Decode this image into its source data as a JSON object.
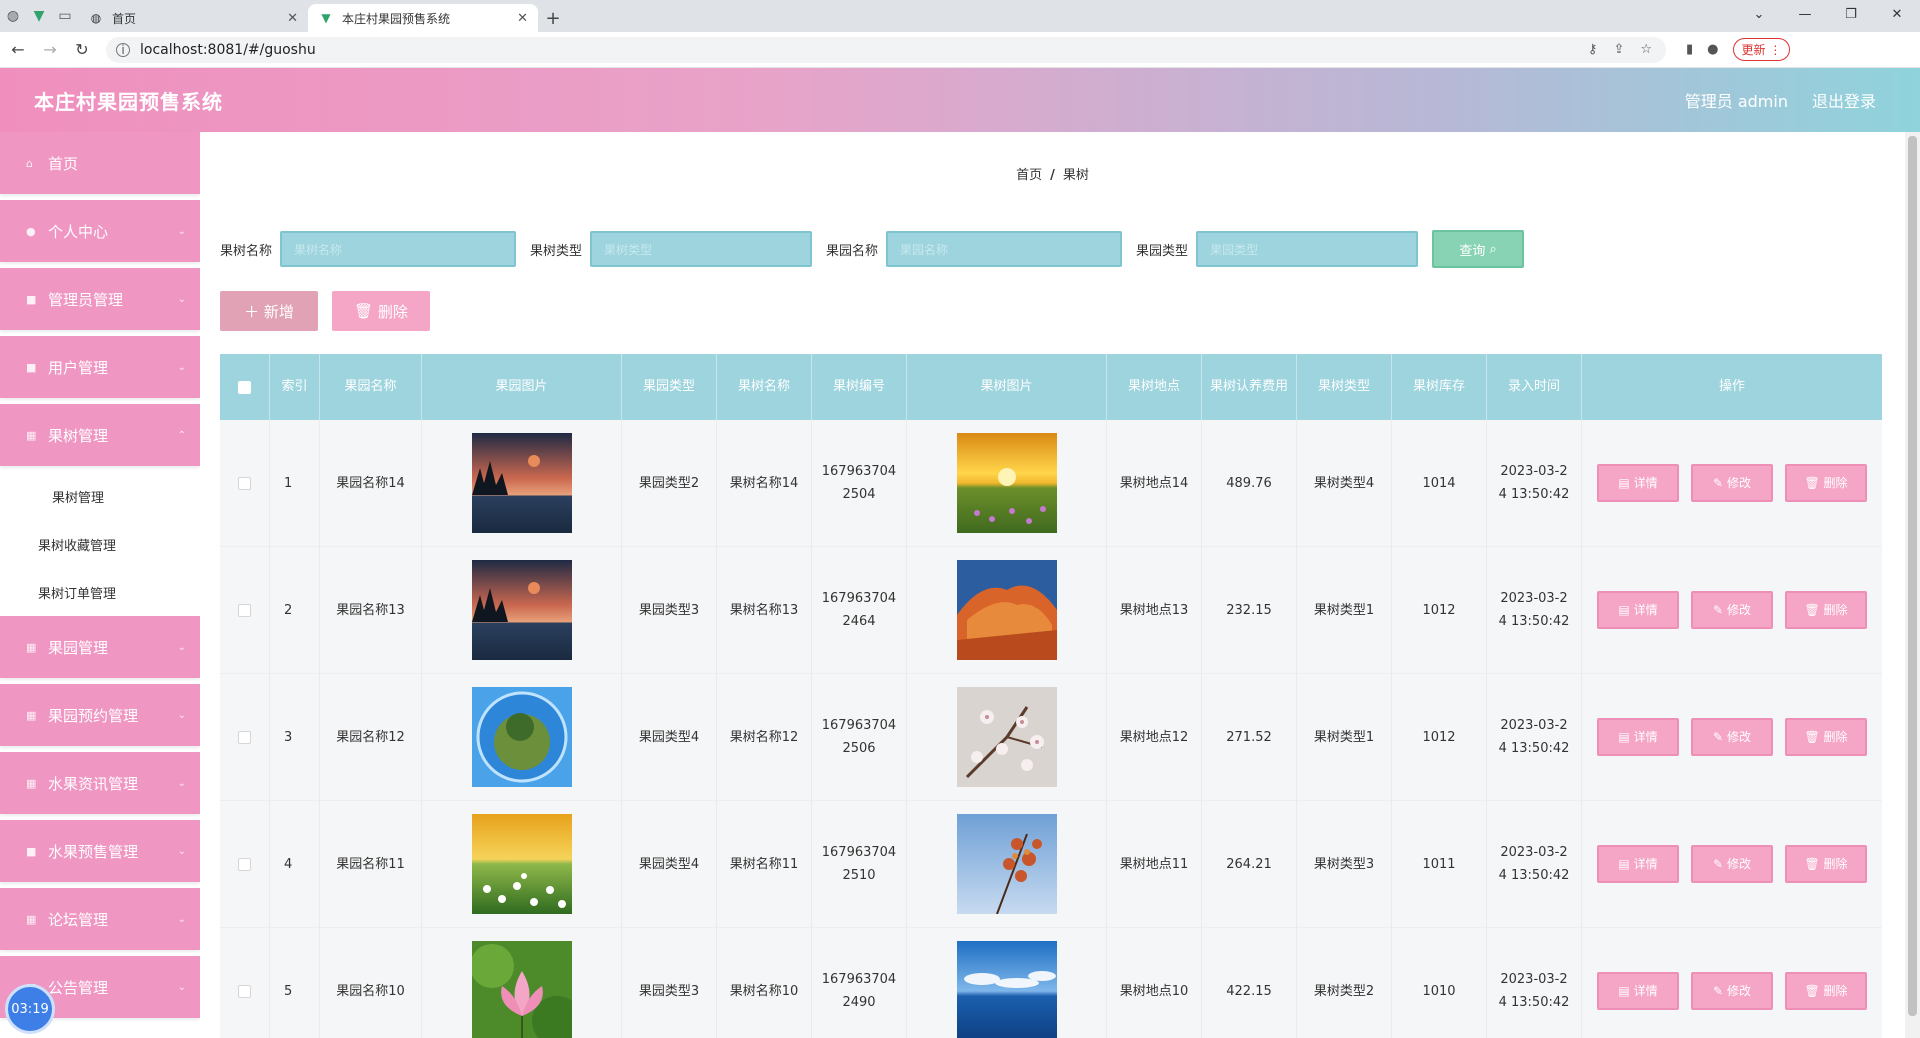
{
  "browser": {
    "tabs": [
      {
        "title": "首页"
      },
      {
        "title": "本庄村果园预售系统"
      }
    ],
    "url": "localhost:8081/#/guoshu",
    "update_label": "更新"
  },
  "header": {
    "title": "本庄村果园预售系统",
    "user": "管理员 admin",
    "logout": "退出登录"
  },
  "sidebar": {
    "items": [
      {
        "label": "首页"
      },
      {
        "label": "个人中心"
      },
      {
        "label": "管理员管理"
      },
      {
        "label": "用户管理"
      },
      {
        "label": "果树管理"
      },
      {
        "label": "果园管理"
      },
      {
        "label": "果园预约管理"
      },
      {
        "label": "水果资讯管理"
      },
      {
        "label": "水果预售管理"
      },
      {
        "label": "论坛管理"
      },
      {
        "label": "公告管理"
      }
    ],
    "submenu": [
      "果树管理",
      "果树收藏管理",
      "果树订单管理"
    ],
    "timer": "03:19"
  },
  "breadcrumb": {
    "home": "首页",
    "sep": "/",
    "current": "果树"
  },
  "search": {
    "labels": [
      "果树名称",
      "果树类型",
      "果园名称",
      "果园类型"
    ],
    "placeholders": [
      "果树名称",
      "果树类型",
      "果园名称",
      "果园类型"
    ],
    "button": "查询"
  },
  "actions": {
    "add": "新增",
    "delete": "删除"
  },
  "table": {
    "headers": [
      "索引",
      "果园名称",
      "果园图片",
      "果园类型",
      "果树名称",
      "果树编号",
      "果树图片",
      "果树地点",
      "果树认养费用",
      "果树类型",
      "果树库存",
      "录入时间",
      "操作"
    ],
    "op_labels": {
      "detail": "详情",
      "edit": "修改",
      "delete": "删除"
    },
    "rows": [
      {
        "index": "1",
        "orchard_name": "果园名称14",
        "orchard_img": "sunset-lake",
        "orchard_type": "果园类型2",
        "tree_name": "果树名称14",
        "tree_no": "1679637042504",
        "tree_img": "sunset-meadow",
        "location": "果树地点14",
        "fee": "489.76",
        "tree_type": "果树类型4",
        "stock": "1014",
        "time": "2023-03-24 13:50:42"
      },
      {
        "index": "2",
        "orchard_name": "果园名称13",
        "orchard_img": "sunset-lake",
        "orchard_type": "果园类型3",
        "tree_name": "果树名称13",
        "tree_no": "1679637042464",
        "tree_img": "red-rock",
        "location": "果树地点13",
        "fee": "232.15",
        "tree_type": "果树类型1",
        "stock": "1012",
        "time": "2023-03-24 13:50:42"
      },
      {
        "index": "3",
        "orchard_name": "果园名称12",
        "orchard_img": "tiny-planet",
        "orchard_type": "果园类型4",
        "tree_name": "果树名称12",
        "tree_no": "1679637042506",
        "tree_img": "blossom",
        "location": "果树地点12",
        "fee": "271.52",
        "tree_type": "果树类型1",
        "stock": "1012",
        "time": "2023-03-24 13:50:42"
      },
      {
        "index": "4",
        "orchard_name": "果园名称11",
        "orchard_img": "daisy-field",
        "orchard_type": "果园类型4",
        "tree_name": "果树名称11",
        "tree_no": "1679637042510",
        "tree_img": "autumn-leaves",
        "location": "果树地点11",
        "fee": "264.21",
        "tree_type": "果树类型3",
        "stock": "1011",
        "time": "2023-03-24 13:50:42"
      },
      {
        "index": "5",
        "orchard_name": "果园名称10",
        "orchard_img": "lotus",
        "orchard_type": "果园类型3",
        "tree_name": "果树名称10",
        "tree_no": "1679637042490",
        "tree_img": "sea-clouds",
        "location": "果树地点10",
        "fee": "422.15",
        "tree_type": "果树类型2",
        "stock": "1010",
        "time": "2023-03-24 13:50:42"
      }
    ]
  },
  "colors": {
    "header_start": "#f08fbe",
    "header_end": "#8fd3dc",
    "menu": "#f096c3",
    "table_head": "#9dd4de",
    "search_btn": "#87d3b4",
    "op_btn": "#f5a6c6"
  }
}
